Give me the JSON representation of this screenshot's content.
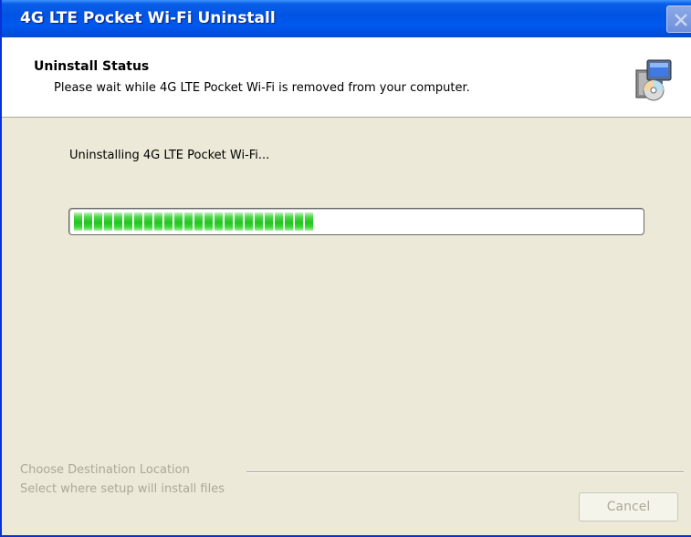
{
  "window": {
    "title": "4G LTE Pocket Wi-Fi Uninstall"
  },
  "header": {
    "title": "Uninstall Status",
    "subtitle": "Please wait while 4G LTE Pocket Wi-Fi is removed from your computer.",
    "icon": "setup-computer-cd-icon"
  },
  "main": {
    "status_text": "Uninstalling 4G LTE Pocket Wi-Fi...",
    "progress_fraction": 0.43
  },
  "footer": {
    "group_title": "Choose Destination Location",
    "group_description": "Select where setup will install files",
    "cancel_label": "Cancel",
    "cancel_enabled": false
  },
  "colors": {
    "titlebar": "#0054E3",
    "dialog_bg": "#ECE9D8",
    "progress_green": "#22C31F",
    "disabled_text": "#ACA899"
  }
}
